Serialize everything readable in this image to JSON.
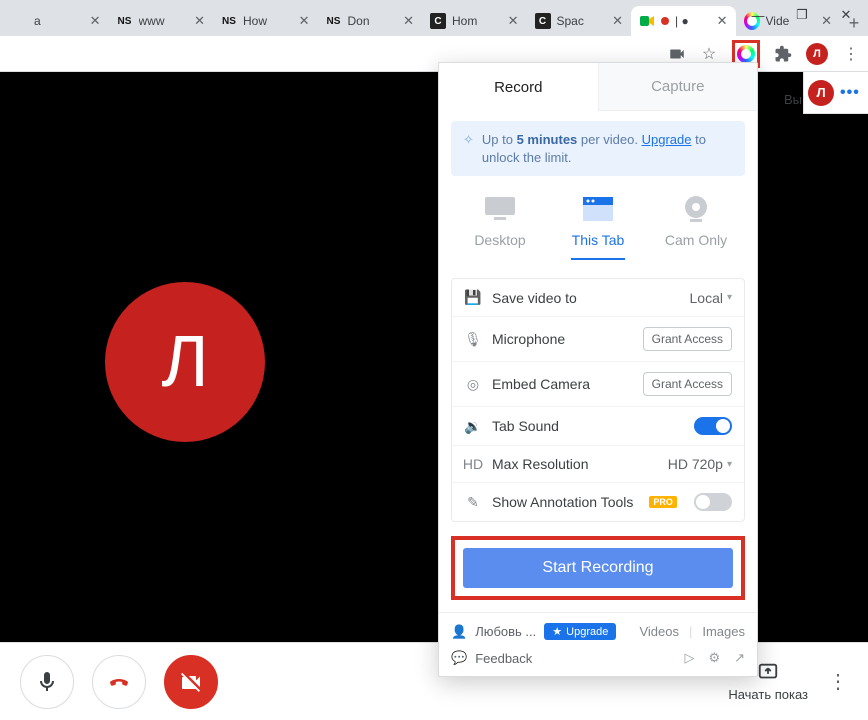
{
  "browser": {
    "tabs": [
      {
        "label": "a",
        "favicon": "generic"
      },
      {
        "label": "www",
        "favicon": "ns"
      },
      {
        "label": "How",
        "favicon": "ns"
      },
      {
        "label": "Don",
        "favicon": "ns"
      },
      {
        "label": "Hom",
        "favicon": "dark"
      },
      {
        "label": "Spac",
        "favicon": "dark"
      },
      {
        "label": "| ●",
        "favicon": "meet",
        "active": true
      },
      {
        "label": "Vide",
        "favicon": "ring"
      }
    ],
    "window_controls": {
      "min": "—",
      "max": "❐",
      "close": "✕"
    },
    "profile_initial": "Л"
  },
  "meet": {
    "avatar_initial": "Л",
    "secondary_label": "Вы",
    "present_label": "Начать показ"
  },
  "panel": {
    "tabs": {
      "record": "Record",
      "capture": "Capture"
    },
    "banner_prefix": "Up to ",
    "banner_bold": "5 minutes",
    "banner_mid": " per video. ",
    "banner_link": "Upgrade",
    "banner_suffix": " to unlock the limit.",
    "modes": {
      "desktop": "Desktop",
      "thistab": "This Tab",
      "camonly": "Cam Only"
    },
    "settings": {
      "save_label": "Save video to",
      "save_value": "Local",
      "mic_label": "Microphone",
      "mic_action": "Grant Access",
      "embed_label": "Embed Camera",
      "embed_action": "Grant Access",
      "sound_label": "Tab Sound",
      "res_label": "Max Resolution",
      "res_value": "HD 720p",
      "anno_label": "Show Annotation Tools",
      "anno_badge": "PRO"
    },
    "start_label": "Start Recording",
    "footer": {
      "user": "Любовь ...",
      "upgrade": "Upgrade",
      "videos": "Videos",
      "images": "Images",
      "feedback": "Feedback"
    }
  }
}
